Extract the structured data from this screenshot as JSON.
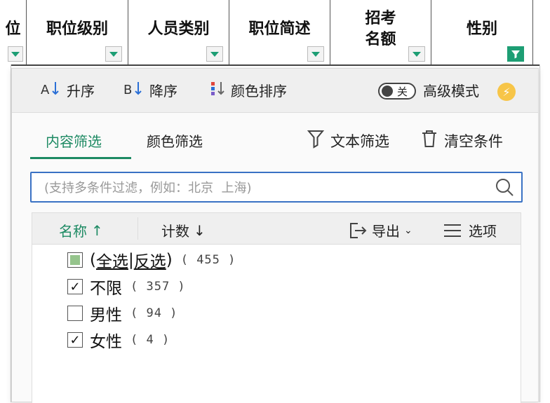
{
  "sheet": {
    "columns": [
      {
        "label": "位"
      },
      {
        "label": "职位级别"
      },
      {
        "label": "人员类别"
      },
      {
        "label": "职位简述"
      },
      {
        "label": "招考名额",
        "line1": "招考",
        "line2": "名额"
      },
      {
        "label": "性别"
      }
    ]
  },
  "sortbar": {
    "asc": "升序",
    "desc": "降序",
    "color_sort": "颜色排序",
    "toggle": "关",
    "advanced": "高级模式"
  },
  "tabs": {
    "content": "内容筛选",
    "color": "颜色筛选",
    "text_filter": "文本筛选",
    "clear": "清空条件"
  },
  "search": {
    "placeholder": "(支持多条件过滤，例如：北京  上海)"
  },
  "list": {
    "name_header": "名称",
    "count_header": "计数",
    "export": "导出",
    "options": "选项",
    "select_all": "全选",
    "invert": "反选",
    "total": "( 455 )",
    "items": [
      {
        "label": "不限",
        "count": "( 357 )",
        "checked": true
      },
      {
        "label": "男性",
        "count": "( 94 )",
        "checked": false
      },
      {
        "label": "女性",
        "count": "( 4 )",
        "checked": true
      }
    ]
  },
  "colors": {
    "accent": "#1d8a63",
    "search_border": "#3a72c4",
    "bolt": "#f7c548"
  }
}
